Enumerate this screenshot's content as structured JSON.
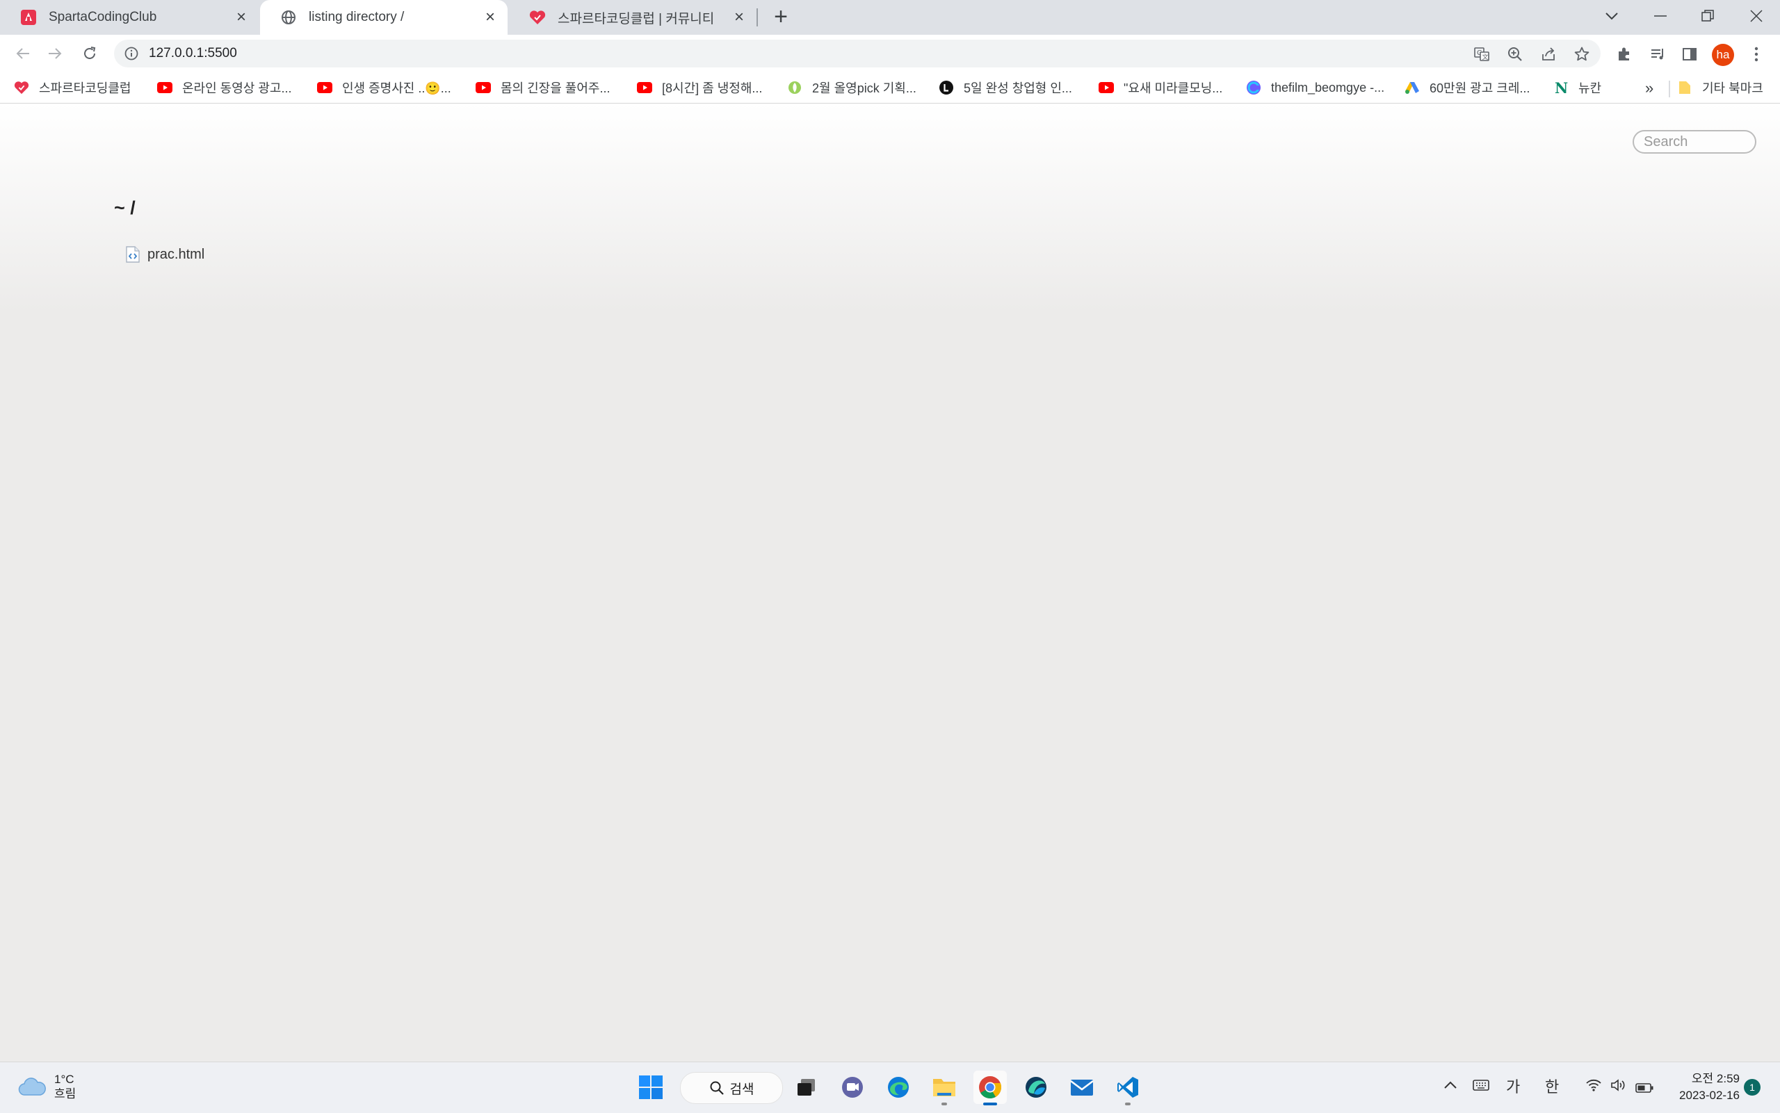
{
  "browser": {
    "tabs": [
      {
        "title": "SpartaCodingClub",
        "favicon": "sparta-icon",
        "active": false
      },
      {
        "title": "listing directory /",
        "favicon": "globe-icon",
        "active": true
      },
      {
        "title": "스파르타코딩클럽 | 커뮤니티",
        "favicon": "sparta-heart-icon",
        "active": false
      }
    ],
    "new_tab": "+",
    "address": "127.0.0.1:5500",
    "profile_initials": "ha"
  },
  "bookmarks": {
    "items": [
      {
        "label": "스파르타코딩클럽",
        "icon": "sparta-heart-icon"
      },
      {
        "label": "온라인 동영상 광고...",
        "icon": "youtube-icon"
      },
      {
        "label": "인생 증명사진 ..🙂...",
        "icon": "youtube-icon"
      },
      {
        "label": "몸의 긴장을 풀어주...",
        "icon": "youtube-icon"
      },
      {
        "label": "[8시간] 좀 냉정해...",
        "icon": "youtube-icon"
      },
      {
        "label": "2월 올영pick 기획...",
        "icon": "oliveyoung-icon"
      },
      {
        "label": "5일 완성 창업형 인...",
        "icon": "l-icon"
      },
      {
        "label": "\"요새 미라클모닝...",
        "icon": "youtube-icon"
      },
      {
        "label": "thefilm_beomgye -...",
        "icon": "c-icon"
      },
      {
        "label": "60만원 광고 크레...",
        "icon": "google-ads-icon"
      },
      {
        "label": "뉴칸",
        "icon": "n-icon"
      }
    ],
    "more": "»",
    "other_folder": "기타 북마크"
  },
  "page": {
    "search_placeholder": "Search",
    "directory": "~ /",
    "files": [
      {
        "name": "prac.html"
      }
    ]
  },
  "taskbar": {
    "weather_temp": "1°C",
    "weather_desc": "흐림",
    "search_label": "검색",
    "ime_mode": "가",
    "ime_lang": "한",
    "time": "오전 2:59",
    "date": "2023-02-16",
    "notifications": "1"
  }
}
